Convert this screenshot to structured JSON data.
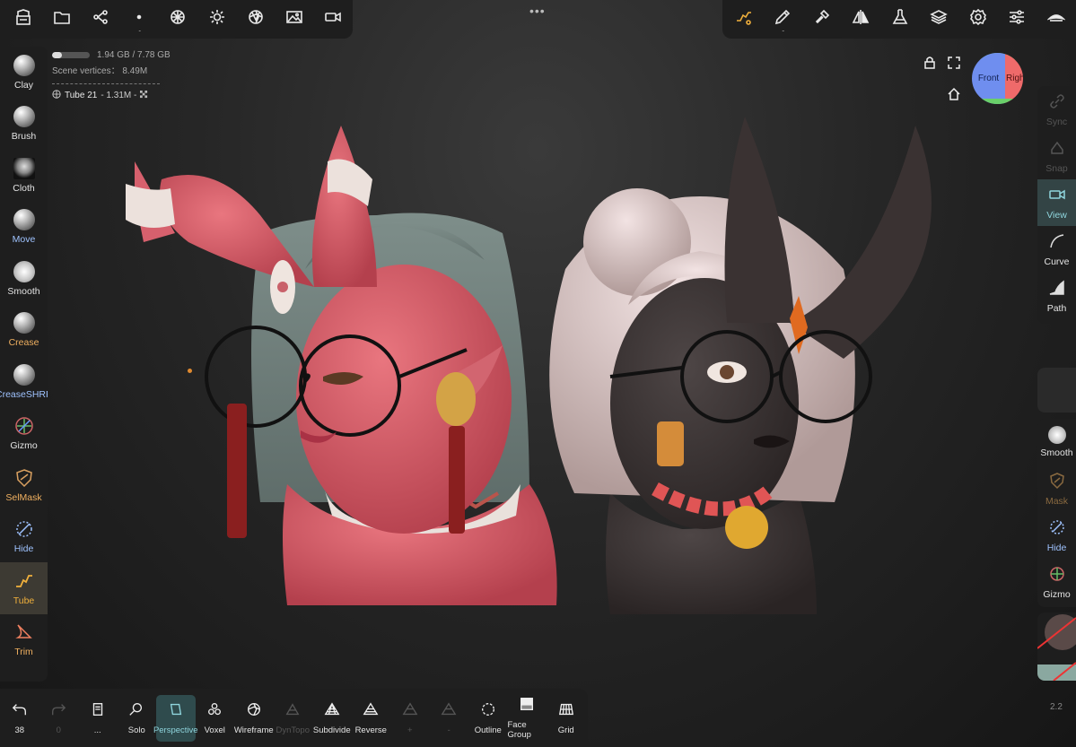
{
  "top_left_toolbar": [
    {
      "name": "scene-menu-icon"
    },
    {
      "name": "files-icon"
    },
    {
      "name": "scene-tree-icon"
    },
    {
      "name": "dot-menu-icon",
      "dots": "..."
    },
    {
      "name": "topology-icon"
    },
    {
      "name": "lighting-icon"
    },
    {
      "name": "shading-icon"
    },
    {
      "name": "background-image-icon"
    },
    {
      "name": "camera-icon"
    }
  ],
  "center_menu": "•••",
  "top_right_toolbar": [
    {
      "name": "tube-stroke-icon",
      "accent": "#f0b03c"
    },
    {
      "name": "pencil-icon",
      "dots": "..."
    },
    {
      "name": "painting-icon"
    },
    {
      "name": "symmetry-icon"
    },
    {
      "name": "material-flask-icon"
    },
    {
      "name": "layers-icon"
    },
    {
      "name": "settings-icon"
    },
    {
      "name": "sliders-icon"
    },
    {
      "name": "hide-ui-icon"
    }
  ],
  "info": {
    "memory": "1.94 GB / 7.78 GB",
    "memory_fraction": 0.25,
    "vertices_label": "Scene vertices：",
    "vertices_value": "8.49M",
    "object_name": "Tube 21",
    "object_detail": "- 1.31M -"
  },
  "nav_cube": {
    "front": "Front",
    "right": "Right"
  },
  "left_tools": [
    {
      "label": "Clay",
      "icon": "clay-sphere-icon"
    },
    {
      "label": "Brush",
      "icon": "brush-sphere-icon"
    },
    {
      "label": "Cloth",
      "icon": "cloth-icon"
    },
    {
      "label": "Move",
      "icon": "move-sphere-icon",
      "color": "blue"
    },
    {
      "label": "Smooth",
      "icon": "smooth-sphere-icon"
    },
    {
      "label": "Crease",
      "icon": "crease-sphere-icon",
      "color": "orange"
    },
    {
      "label": "CreaseSHRP",
      "icon": "creaseshrp-sphere-icon",
      "color": "blue"
    },
    {
      "label": "Gizmo",
      "icon": "gizmo-icon"
    },
    {
      "label": "SelMask",
      "icon": "selmask-icon",
      "color": "orange"
    },
    {
      "label": "Hide",
      "icon": "hide-icon",
      "color": "blue"
    },
    {
      "label": "Tube",
      "icon": "tube-icon",
      "active": true
    },
    {
      "label": "Trim",
      "icon": "trim-icon",
      "color": "orange"
    }
  ],
  "right_tools_top": [
    {
      "label": "Sync",
      "icon": "link-icon",
      "dim": true
    },
    {
      "label": "Snap",
      "icon": "snap-icon",
      "dim": true
    },
    {
      "label": "View",
      "icon": "video-icon",
      "active": true
    },
    {
      "label": "Curve",
      "icon": "curve-icon"
    },
    {
      "label": "Path",
      "icon": "path-icon"
    }
  ],
  "right_tools_bottom": [
    {
      "label": "Smooth",
      "icon": "smooth-sphere-icon"
    },
    {
      "label": "Mask",
      "icon": "mask-icon",
      "dim": true
    },
    {
      "label": "Hide",
      "icon": "hide-icon",
      "color": "blue"
    },
    {
      "label": "Gizmo",
      "icon": "gizmo-icon"
    }
  ],
  "bottom_tools": [
    {
      "label": "38",
      "icon": "undo-icon"
    },
    {
      "label": "0",
      "icon": "redo-icon",
      "dim": true
    },
    {
      "label": "...",
      "icon": "document-icon"
    },
    {
      "label": "Solo",
      "icon": "search-icon"
    },
    {
      "label": "Perspective",
      "icon": "perspective-icon",
      "active": true
    },
    {
      "label": "Voxel",
      "icon": "voxel-icon"
    },
    {
      "label": "Wireframe",
      "icon": "wireframe-icon"
    },
    {
      "label": "DynTopo",
      "icon": "dyntopo-icon",
      "dim": true
    },
    {
      "label": "Subdivide",
      "icon": "subdivide-icon"
    },
    {
      "label": "Reverse",
      "icon": "reverse-icon"
    },
    {
      "label": "+",
      "icon": "plus-icon",
      "dim": true
    },
    {
      "label": "-",
      "icon": "minus-icon",
      "dim": true
    },
    {
      "label": "Outline",
      "icon": "outline-icon"
    },
    {
      "label": "Face Group",
      "icon": "face-group-icon"
    },
    {
      "label": "Grid",
      "icon": "grid-icon"
    }
  ],
  "version": "2.2",
  "colors": {
    "accent": "#f0b03c",
    "active_teal": "#8fd5dd",
    "panel": "#1e1e1e"
  }
}
